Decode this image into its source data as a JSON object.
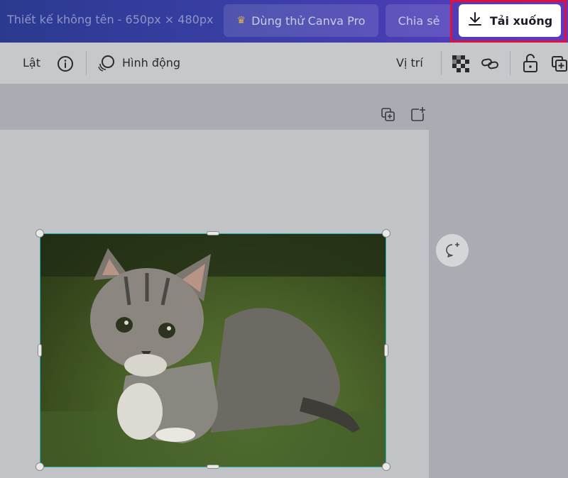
{
  "header": {
    "doc_title": "Thiết kế không tên - 650px × 480px",
    "try_pro_label": "Dùng thử Canva Pro",
    "share_label": "Chia sẻ",
    "download_label": "Tải xuống",
    "highlight_color": "#e0103a"
  },
  "toolbar": {
    "flip_label": "Lật",
    "animate_label": "Hình động",
    "position_label": "Vị trí"
  },
  "icons": {
    "crown": "crown-icon",
    "download": "download-icon",
    "info": "info-icon",
    "animate": "animate-icon",
    "transparency": "transparency-icon",
    "link": "link-icon",
    "lock": "unlock-icon",
    "duplicate": "duplicate-icon",
    "add_page": "add-page-icon",
    "comment": "add-comment-icon"
  }
}
